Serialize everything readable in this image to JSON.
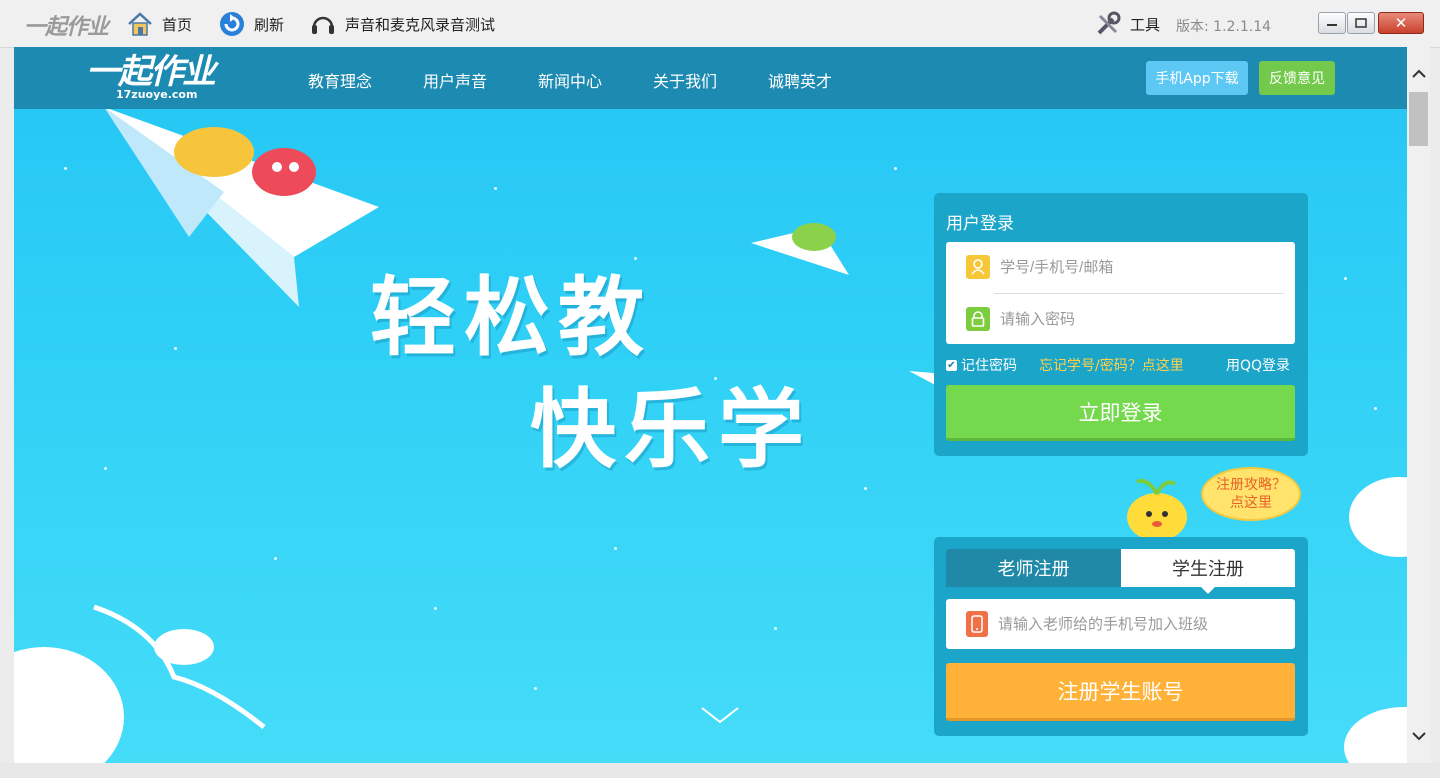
{
  "titlebar": {
    "app_logo": "一起作业",
    "home": "首页",
    "refresh": "刷新",
    "audio_test": "声音和麦克风录音测试",
    "tools": "工具",
    "version": "版本: 1.2.1.14"
  },
  "site": {
    "logo": "一起作业",
    "logo_sub": "17zuoye.com",
    "nav": [
      "教育理念",
      "用户声音",
      "新闻中心",
      "关于我们",
      "诚聘英才"
    ],
    "app_download": "手机App下载",
    "feedback": "反馈意见"
  },
  "hero": {
    "line1": "轻松教",
    "line2": "快乐学"
  },
  "login": {
    "title": "用户登录",
    "username_placeholder": "学号/手机号/邮箱",
    "password_placeholder": "请输入密码",
    "remember": "记住密码",
    "forgot": "忘记学号/密码？点这里",
    "qq_login": "用QQ登录",
    "submit": "立即登录"
  },
  "register_tip": {
    "line1": "注册攻略？",
    "line2": "点这里"
  },
  "register": {
    "tab_teacher": "老师注册",
    "tab_student": "学生注册",
    "phone_placeholder": "请输入老师给的手机号加入班级",
    "submit": "注册学生账号"
  },
  "colors": {
    "sky": "#2fd0f6",
    "nav": "#1d8ab1",
    "panel": "#1aa5c9",
    "login_green": "#74d94d",
    "register_orange": "#ffb237"
  }
}
